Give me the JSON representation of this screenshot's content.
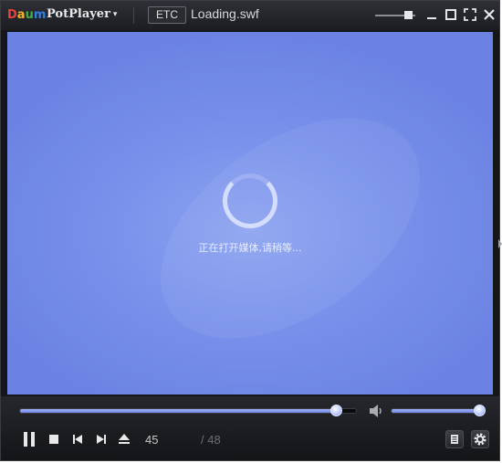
{
  "app": {
    "logo_letters": [
      "D",
      "a",
      "u",
      "m"
    ],
    "logo_colors": [
      "#e8423a",
      "#f0b42a",
      "#3fae49",
      "#2f7ee6"
    ],
    "name": "PotPlayer",
    "menu_caret": "▾"
  },
  "titlebar": {
    "etc_label": "ETC",
    "file_title": "Loading.swf",
    "icons": [
      "opacity-slider",
      "minimize-icon",
      "maximize-icon",
      "fullscreen-icon",
      "close-icon"
    ]
  },
  "video": {
    "background": "#7a92eb",
    "loading_text": "正在打开媒体,请稍等..."
  },
  "controls": {
    "seek_fraction": 0.94,
    "volume_fraction": 1.0,
    "accent": "#7f95ea",
    "current_time": "45",
    "total_time": "/ 48",
    "buttons": [
      "pause-icon",
      "stop-icon",
      "previous-icon",
      "next-icon",
      "eject-icon",
      "playlist-icon",
      "settings-icon"
    ]
  }
}
